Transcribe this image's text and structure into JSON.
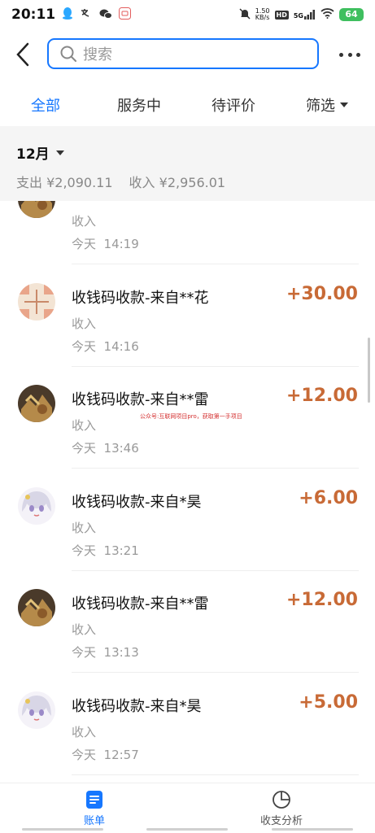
{
  "status_bar": {
    "time": "20:11",
    "net_speed_value": "1.50",
    "net_speed_unit": "KB/s",
    "hd": "HD",
    "signal": "5G",
    "battery": "64"
  },
  "header": {
    "search_placeholder": "搜索"
  },
  "tabs": [
    {
      "label": "全部",
      "active": true
    },
    {
      "label": "服务中",
      "active": false
    },
    {
      "label": "待评价",
      "active": false
    },
    {
      "label": "筛选",
      "active": false
    }
  ],
  "month": {
    "label": "12月",
    "expense_label": "支出",
    "expense_value": "¥2,090.11",
    "income_label": "收入",
    "income_value": "¥2,956.01"
  },
  "transactions": [
    {
      "title": "",
      "type": "收入",
      "time": "今天  14:19",
      "amount": "",
      "avatar": "food"
    },
    {
      "title": "收钱码收款-来自**花",
      "type": "收入",
      "time": "今天  14:16",
      "amount": "+30.00",
      "avatar": "pattern"
    },
    {
      "title": "收钱码收款-来自**雷",
      "type": "收入",
      "time": "今天  13:46",
      "amount": "+12.00",
      "avatar": "food"
    },
    {
      "title": "收钱码收款-来自*昊",
      "type": "收入",
      "time": "今天  13:21",
      "amount": "+6.00",
      "avatar": "anime"
    },
    {
      "title": "收钱码收款-来自**雷",
      "type": "收入",
      "time": "今天  13:13",
      "amount": "+12.00",
      "avatar": "food"
    },
    {
      "title": "收钱码收款-来自*昊",
      "type": "收入",
      "time": "今天  12:57",
      "amount": "+5.00",
      "avatar": "anime"
    }
  ],
  "watermark": "公众号:互联网项目pro，获取第一手项目",
  "bottom_nav": [
    {
      "label": "账单",
      "icon": "bill-icon",
      "active": true
    },
    {
      "label": "收支分析",
      "icon": "pie-chart-icon",
      "active": false
    }
  ],
  "colors": {
    "accent": "#1677ff",
    "amount": "#c86a36",
    "summary_bg": "#f5f5f5"
  }
}
